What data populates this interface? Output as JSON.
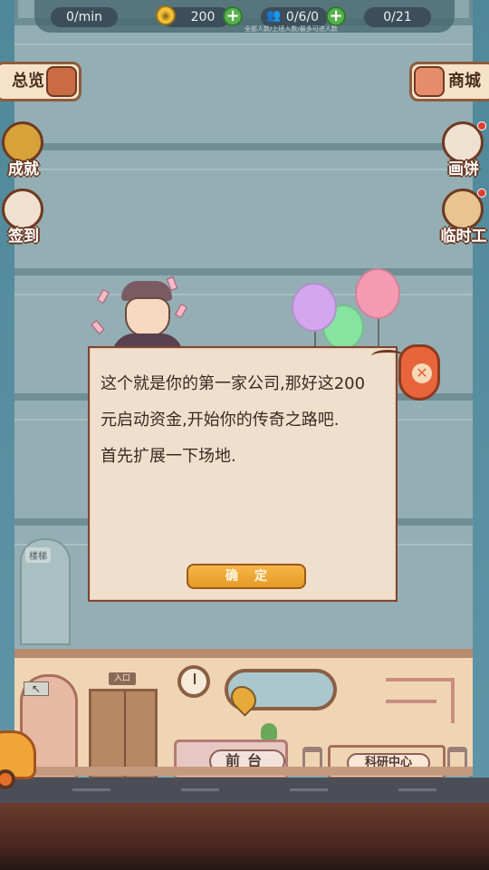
{
  "top_bar": {
    "income_rate": "0/min",
    "gold": "200",
    "staff": "0/6/0",
    "staff_caption": "全部人数/上班人数/最多可进人数",
    "progress": "0/21"
  },
  "left_menu": {
    "overview_label": "总览",
    "achievement_label": "成就",
    "signin_label": "签到"
  },
  "right_menu": {
    "shop_label": "商城",
    "draw_label": "画饼",
    "temp_worker_label": "临时工"
  },
  "building": {
    "stair_sign": "楼梯",
    "elevator_sign": "入口",
    "reception_label": "前台",
    "research_label": "科研中心"
  },
  "dialog": {
    "line1": "这个就是你的第一家公司,那好这200",
    "line2": "元启动资金,开始你的传奇之路吧.",
    "line3": "首先扩展一下场地.",
    "confirm_label": "确定",
    "close_glyph": "✕"
  },
  "colors": {
    "accent": "#e69a27",
    "dialog_bg": "#f1dfcd",
    "dialog_border": "#7d4634",
    "plus_green": "#57b04d"
  },
  "icons": [
    "gold-coin-icon",
    "staff-icon",
    "plus-icon",
    "overview-icon",
    "achievement-icon",
    "signin-icon",
    "shop-icon",
    "draw-icon",
    "temp-worker-icon",
    "close-icon",
    "location-pin-icon"
  ]
}
